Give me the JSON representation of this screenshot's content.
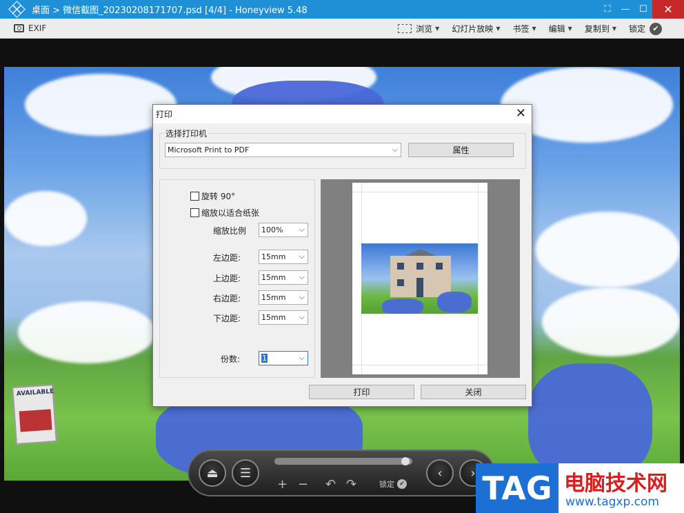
{
  "window": {
    "title": "桌面 > 微信截图_20230208171707.psd [4/4] - Honeyview 5.48",
    "controls": [
      "fullscreen-icon",
      "minimize-icon",
      "maximize-icon",
      "close-icon"
    ]
  },
  "toolbar": {
    "exif_label": "EXIF",
    "browse_label": "浏览",
    "slideshow_label": "幻灯片放映",
    "bookmark_label": "书签",
    "edit_label": "编辑",
    "copy_to_label": "复制到",
    "lock_label": "锁定"
  },
  "dialog": {
    "title": "打印",
    "printer_group_label": "选择打印机",
    "printer_selected": "Microsoft Print to PDF",
    "properties_button": "属性",
    "rotate_label": "旋转 90°",
    "fit_paper_label": "缩放以适合纸张",
    "scale_label": "缩放比例",
    "scale_value": "100%",
    "left_margin_label": "左边距:",
    "left_margin_value": "15mm",
    "top_margin_label": "上边距:",
    "top_margin_value": "15mm",
    "right_margin_label": "右边距:",
    "right_margin_value": "15mm",
    "bottom_margin_label": "下边距:",
    "bottom_margin_value": "15mm",
    "copies_label": "份数:",
    "copies_value": "1",
    "print_button": "打印",
    "close_button": "关闭"
  },
  "controlbar": {
    "lock_label": "锁定"
  },
  "watermark": {
    "tag": "TAG",
    "cn_text": "电脑技术网",
    "url": "www.tagxp.com"
  },
  "colors": {
    "titlebar": "#1f8fd6",
    "dialog_bg": "#f0f0f0",
    "watermark_blue": "#1c6fd3",
    "watermark_red": "#d81e1e"
  }
}
